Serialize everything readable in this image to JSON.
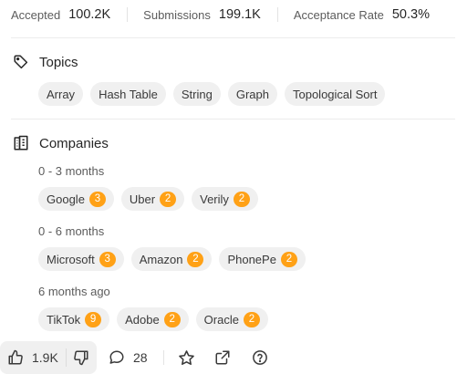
{
  "stats": [
    {
      "label": "Accepted",
      "value": "100.2K"
    },
    {
      "label": "Submissions",
      "value": "199.1K"
    },
    {
      "label": "Acceptance Rate",
      "value": "50.3%"
    }
  ],
  "topics": {
    "title": "Topics",
    "icon": "tag-icon",
    "items": [
      "Array",
      "Hash Table",
      "String",
      "Graph",
      "Topological Sort"
    ]
  },
  "companies": {
    "title": "Companies",
    "icon": "building-icon",
    "groups": [
      {
        "period": "0 - 3 months",
        "items": [
          {
            "name": "Google",
            "count": "3"
          },
          {
            "name": "Uber",
            "count": "2"
          },
          {
            "name": "Verily",
            "count": "2"
          }
        ]
      },
      {
        "period": "0 - 6 months",
        "items": [
          {
            "name": "Microsoft",
            "count": "3"
          },
          {
            "name": "Amazon",
            "count": "2"
          },
          {
            "name": "PhonePe",
            "count": "2"
          }
        ]
      },
      {
        "period": "6 months ago",
        "items": [
          {
            "name": "TikTok",
            "count": "9"
          },
          {
            "name": "Adobe",
            "count": "2"
          },
          {
            "name": "Oracle",
            "count": "2"
          }
        ]
      }
    ]
  },
  "actions": {
    "likes": "1.9K",
    "comments": "28",
    "like_icon": "thumbs-up-icon",
    "dislike_icon": "thumbs-down-icon",
    "comment_icon": "comment-icon",
    "star_icon": "star-icon",
    "share_icon": "share-icon",
    "help_icon": "question-icon"
  },
  "colors": {
    "badge": "#ffa116",
    "chip": "#f0f0f0"
  }
}
